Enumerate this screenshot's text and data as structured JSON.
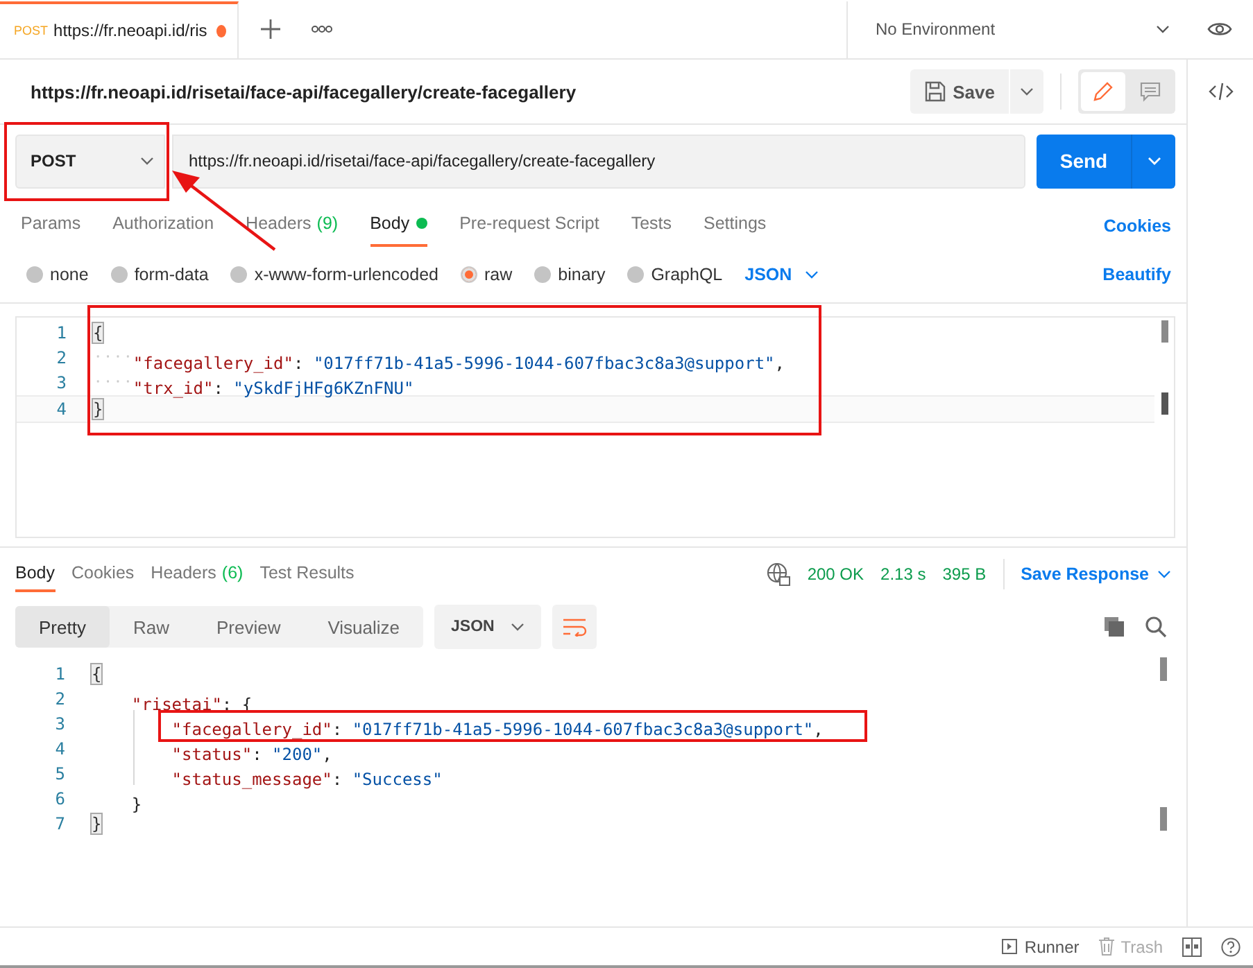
{
  "tab": {
    "method": "POST",
    "title": "https://fr.neoapi.id/ris",
    "unsaved": true
  },
  "environment": "No Environment",
  "request": {
    "title": "https://fr.neoapi.id/risetai/face-api/facegallery/create-facegallery",
    "save": "Save",
    "method": "POST",
    "url": "https://fr.neoapi.id/risetai/face-api/facegallery/create-facegallery",
    "send": "Send"
  },
  "mode_toggle": [
    {
      "kind": "edit",
      "selected": true
    },
    {
      "kind": "comment",
      "selected": false
    }
  ],
  "request_tabs": [
    {
      "label": "Params",
      "selected": false
    },
    {
      "label": "Authorization",
      "selected": false
    },
    {
      "label": "Headers",
      "count": "(9)",
      "selected": false
    },
    {
      "label": "Body",
      "selected": true,
      "dot": true
    },
    {
      "label": "Pre-request Script",
      "selected": false
    },
    {
      "label": "Tests",
      "selected": false
    },
    {
      "label": "Settings",
      "selected": false
    }
  ],
  "cookies": "Cookies",
  "body_types": [
    {
      "label": "none",
      "selected": false
    },
    {
      "label": "form-data",
      "selected": false
    },
    {
      "label": "x-www-form-urlencoded",
      "selected": false
    },
    {
      "label": "raw",
      "selected": true
    },
    {
      "label": "binary",
      "selected": false
    },
    {
      "label": "GraphQL",
      "selected": false
    }
  ],
  "body_format": "JSON",
  "beautify": "Beautify",
  "request_body": [
    {
      "n": "1",
      "current": false,
      "tokens": [
        {
          "kind": "brace-match",
          "text": "{"
        }
      ]
    },
    {
      "n": "2",
      "current": false,
      "tokens": [
        {
          "kind": "indent-dots"
        },
        {
          "kind": "key",
          "text": "\"facegallery_id\""
        },
        {
          "kind": "punct",
          "text": ": "
        },
        {
          "kind": "string",
          "text": "\"017ff71b-41a5-5996-1044-607fbac3c8a3@support\""
        },
        {
          "kind": "punct",
          "text": ","
        }
      ]
    },
    {
      "n": "3",
      "current": false,
      "tokens": [
        {
          "kind": "indent-dots"
        },
        {
          "kind": "key",
          "text": "\"trx_id\""
        },
        {
          "kind": "punct",
          "text": ": "
        },
        {
          "kind": "string",
          "text": "\"ySkdFjHFg6KZnFNU\""
        }
      ]
    },
    {
      "n": "4",
      "current": true,
      "tokens": [
        {
          "kind": "brace-match",
          "text": "}"
        }
      ]
    }
  ],
  "response_tabs": [
    {
      "label": "Body",
      "selected": true
    },
    {
      "label": "Cookies",
      "selected": false
    },
    {
      "label": "Headers",
      "count": "(6)",
      "selected": false
    },
    {
      "label": "Test Results",
      "selected": false
    }
  ],
  "response_status": {
    "code": "200 OK",
    "time": "2.13 s",
    "size": "395 B"
  },
  "save_response": "Save Response",
  "view_modes": [
    {
      "label": "Pretty",
      "selected": true
    },
    {
      "label": "Raw",
      "selected": false
    },
    {
      "label": "Preview",
      "selected": false
    },
    {
      "label": "Visualize",
      "selected": false
    }
  ],
  "response_format": "JSON",
  "response_body": [
    {
      "n": "1",
      "tokens": [
        {
          "kind": "brace-match",
          "text": "{"
        }
      ]
    },
    {
      "n": "2",
      "tokens": [
        {
          "kind": "indent"
        },
        {
          "kind": "key",
          "text": "\"risetai\""
        },
        {
          "kind": "punct",
          "text": ": {"
        }
      ]
    },
    {
      "n": "3",
      "tokens": [
        {
          "kind": "indent"
        },
        {
          "kind": "indent-guide"
        },
        {
          "kind": "key",
          "text": "\"facegallery_id\""
        },
        {
          "kind": "punct",
          "text": ": "
        },
        {
          "kind": "string",
          "text": "\"017ff71b-41a5-5996-1044-607fbac3c8a3@support\""
        },
        {
          "kind": "punct",
          "text": ","
        }
      ]
    },
    {
      "n": "4",
      "tokens": [
        {
          "kind": "indent"
        },
        {
          "kind": "indent-guide"
        },
        {
          "kind": "key",
          "text": "\"status\""
        },
        {
          "kind": "punct",
          "text": ": "
        },
        {
          "kind": "string",
          "text": "\"200\""
        },
        {
          "kind": "punct",
          "text": ","
        }
      ]
    },
    {
      "n": "5",
      "tokens": [
        {
          "kind": "indent"
        },
        {
          "kind": "indent-guide"
        },
        {
          "kind": "key",
          "text": "\"status_message\""
        },
        {
          "kind": "punct",
          "text": ": "
        },
        {
          "kind": "string",
          "text": "\"Success\""
        }
      ]
    },
    {
      "n": "6",
      "tokens": [
        {
          "kind": "indent"
        },
        {
          "kind": "punct",
          "text": "}"
        }
      ]
    },
    {
      "n": "7",
      "tokens": [
        {
          "kind": "brace-match",
          "text": "}"
        }
      ]
    }
  ],
  "status_bar": {
    "runner": "Runner",
    "trash": "Trash"
  }
}
